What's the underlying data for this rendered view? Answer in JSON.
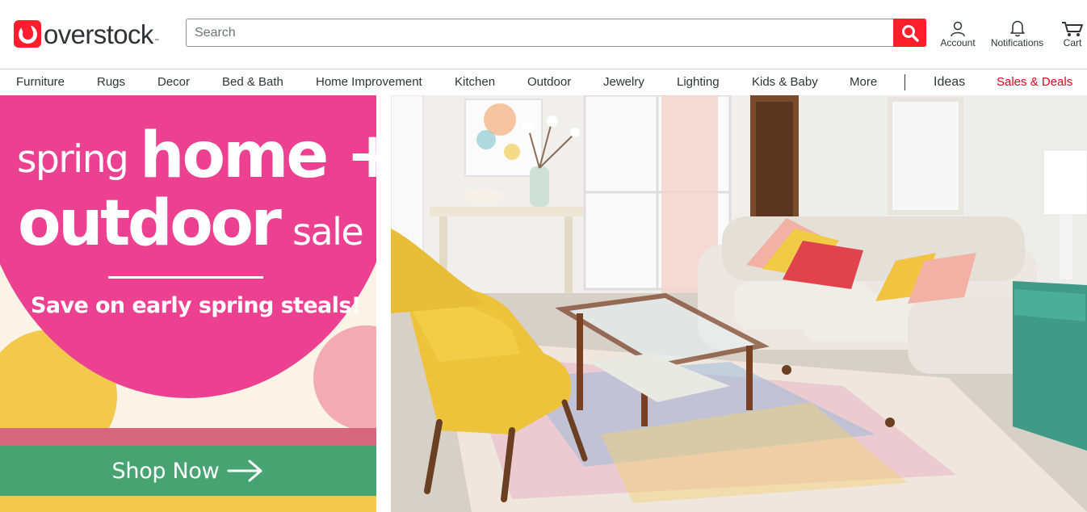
{
  "header": {
    "logo_text": "overstock",
    "logo_tm": "™",
    "search_placeholder": "Search",
    "search_value": "",
    "search_icon": "magnifier-icon",
    "account_label": "Account",
    "notifications_label": "Notifications",
    "cart_label": "Cart",
    "brand_color": "#ff1f2c"
  },
  "nav": {
    "items": [
      "Furniture",
      "Rugs",
      "Decor",
      "Bed & Bath",
      "Home Improvement",
      "Kitchen",
      "Outdoor",
      "Jewelry",
      "Lighting",
      "Kids & Baby",
      "More"
    ],
    "ideas": "Ideas",
    "deals": "Sales & Deals",
    "deals_color": "#e5001c"
  },
  "hero": {
    "line_spring": "spring",
    "line_home": "home +",
    "line_outdoor": "outdoor",
    "line_sale": "sale",
    "tagline": "Save on early spring steals!",
    "cta": "Shop Now",
    "cta_icon": "arrow-right-icon",
    "colors": {
      "pink": "#ec4191",
      "green": "#48a373",
      "yellow": "#f3c94d",
      "rose": "#d6677e",
      "cream": "#fbf4e6"
    },
    "image": "living-room-photo"
  }
}
